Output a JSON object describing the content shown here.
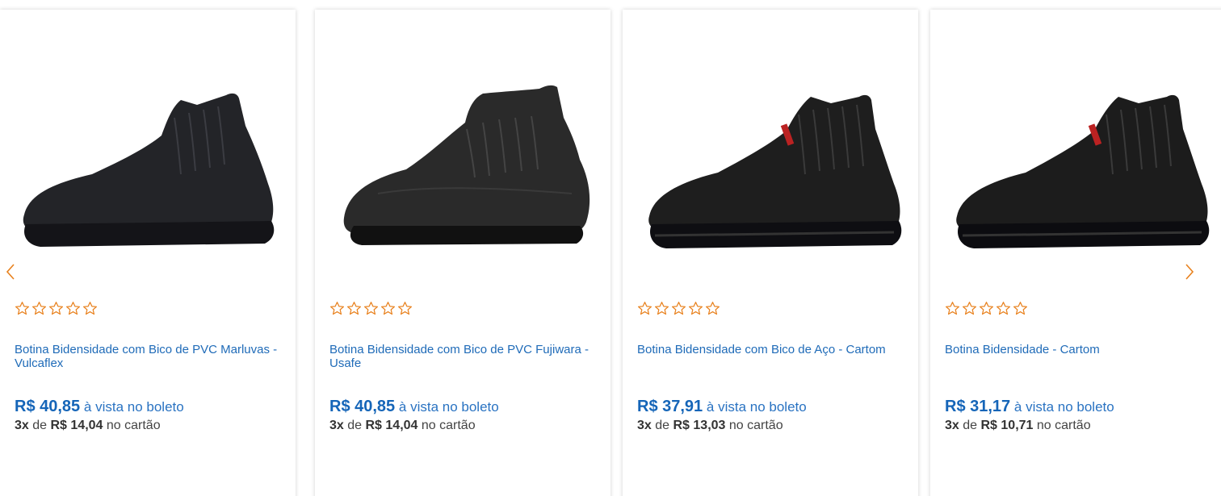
{
  "colors": {
    "accent": "#1f6bb8",
    "star": "#e8811d",
    "arrow": "#e8811d"
  },
  "carousel": {
    "prev_icon": "chevron-left-icon",
    "next_icon": "chevron-right-icon"
  },
  "products": [
    {
      "name": "Botina Bidensidade com Bico de PVC Fujiwara - Usafe",
      "rating": 0,
      "price": "R$ 40,85",
      "price_label": "à vista no boleto",
      "installments_count": "3x",
      "installments_of": "de",
      "installment_value": "R$ 14,04",
      "installments_label": "no cartão"
    },
    {
      "name": "Botina Bidensidade com Bico de Aço - Cartom",
      "rating": 0,
      "price": "R$ 37,91",
      "price_label": "à vista no boleto",
      "installments_count": "3x",
      "installments_of": "de",
      "installment_value": "R$ 13,03",
      "installments_label": "no cartão"
    },
    {
      "name": "Botina Bidensidade - Cartom",
      "rating": 0,
      "price": "R$ 31,17",
      "price_label": "à vista no boleto",
      "installments_count": "3x",
      "installments_of": "de",
      "installment_value": "R$ 10,71",
      "installments_label": "no cartão"
    },
    {
      "name": "Botina Bidensidade com Bico de PVC Marluvas - Vulcaflex",
      "rating": 0,
      "price": "R$ 40,85",
      "price_label": "à vista no boleto",
      "installments_count": "3x",
      "installments_of": "de",
      "installment_value": "R$ 14,04",
      "installments_label": "no cartão"
    }
  ]
}
